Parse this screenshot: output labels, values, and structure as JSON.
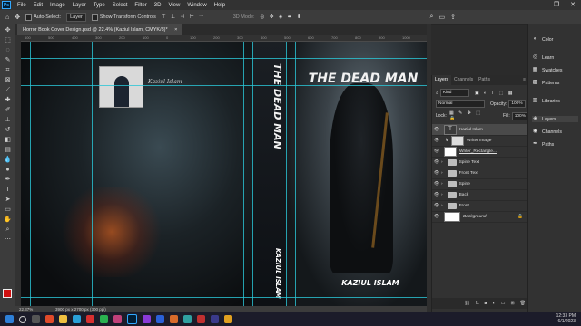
{
  "app": {
    "logo": "Ps",
    "brand_color": "#31a8ff"
  },
  "menu": [
    "File",
    "Edit",
    "Image",
    "Layer",
    "Type",
    "Select",
    "Filter",
    "3D",
    "View",
    "Window",
    "Help"
  ],
  "window_controls": [
    "—",
    "❐",
    "✕"
  ],
  "options": {
    "auto_select_label": "Auto-Select:",
    "auto_select_value": "Layer",
    "transform_label": "Show Transform Controls",
    "mode_3d": "3D Mode:"
  },
  "document": {
    "tab_title": "Horror Book Cover Design.psd @ 22.4% (Kaziul Islam, CMYK/8)*",
    "tab_close": "×",
    "ruler_marks": [
      "600",
      "500",
      "400",
      "300",
      "200",
      "100",
      "0",
      "100",
      "200",
      "300",
      "400",
      "500",
      "600",
      "700",
      "800",
      "900",
      "1000"
    ]
  },
  "cover": {
    "front_title": "THE DEAD MAN",
    "spine_title": "THE DEAD MAN",
    "front_author": "KAZIUL ISLAM",
    "spine_author": "KAZIUL ISLAM",
    "signature": "Kaziul Islam"
  },
  "status": {
    "zoom": "22.37%",
    "doc_size": "3900 px x 2700 px (300 ppi)"
  },
  "layers_panel": {
    "tabs": [
      "Layers",
      "Channels",
      "Paths"
    ],
    "kind": "Kind",
    "blend_mode": "Normal",
    "opacity_label": "Opacity:",
    "opacity_value": "100%",
    "lock_label": "Lock:",
    "fill_label": "Fill:",
    "fill_value": "100%",
    "layers": [
      {
        "name": "Kaziul Islam",
        "type": "text",
        "selected": true
      },
      {
        "name": "Writer Image",
        "type": "image"
      },
      {
        "name": "Writer_Rectangle...",
        "type": "shape"
      },
      {
        "name": "Spine Text",
        "type": "group"
      },
      {
        "name": "Front Text",
        "type": "group"
      },
      {
        "name": "Spine",
        "type": "group"
      },
      {
        "name": "Back",
        "type": "group"
      },
      {
        "name": "Front",
        "type": "group"
      },
      {
        "name": "Background",
        "type": "background",
        "locked": true
      }
    ],
    "footer_icons": [
      "link-icon",
      "fx-icon",
      "mask-icon",
      "adjustment-icon",
      "folder-icon",
      "new-layer-icon",
      "trash-icon"
    ]
  },
  "dock": [
    "Color",
    "Learn",
    "Swatches",
    "Patterns",
    "Libraries",
    "Layers",
    "Channels",
    "Paths"
  ],
  "taskbar": {
    "time": "12:33 PM",
    "date": "6/1/2023"
  }
}
